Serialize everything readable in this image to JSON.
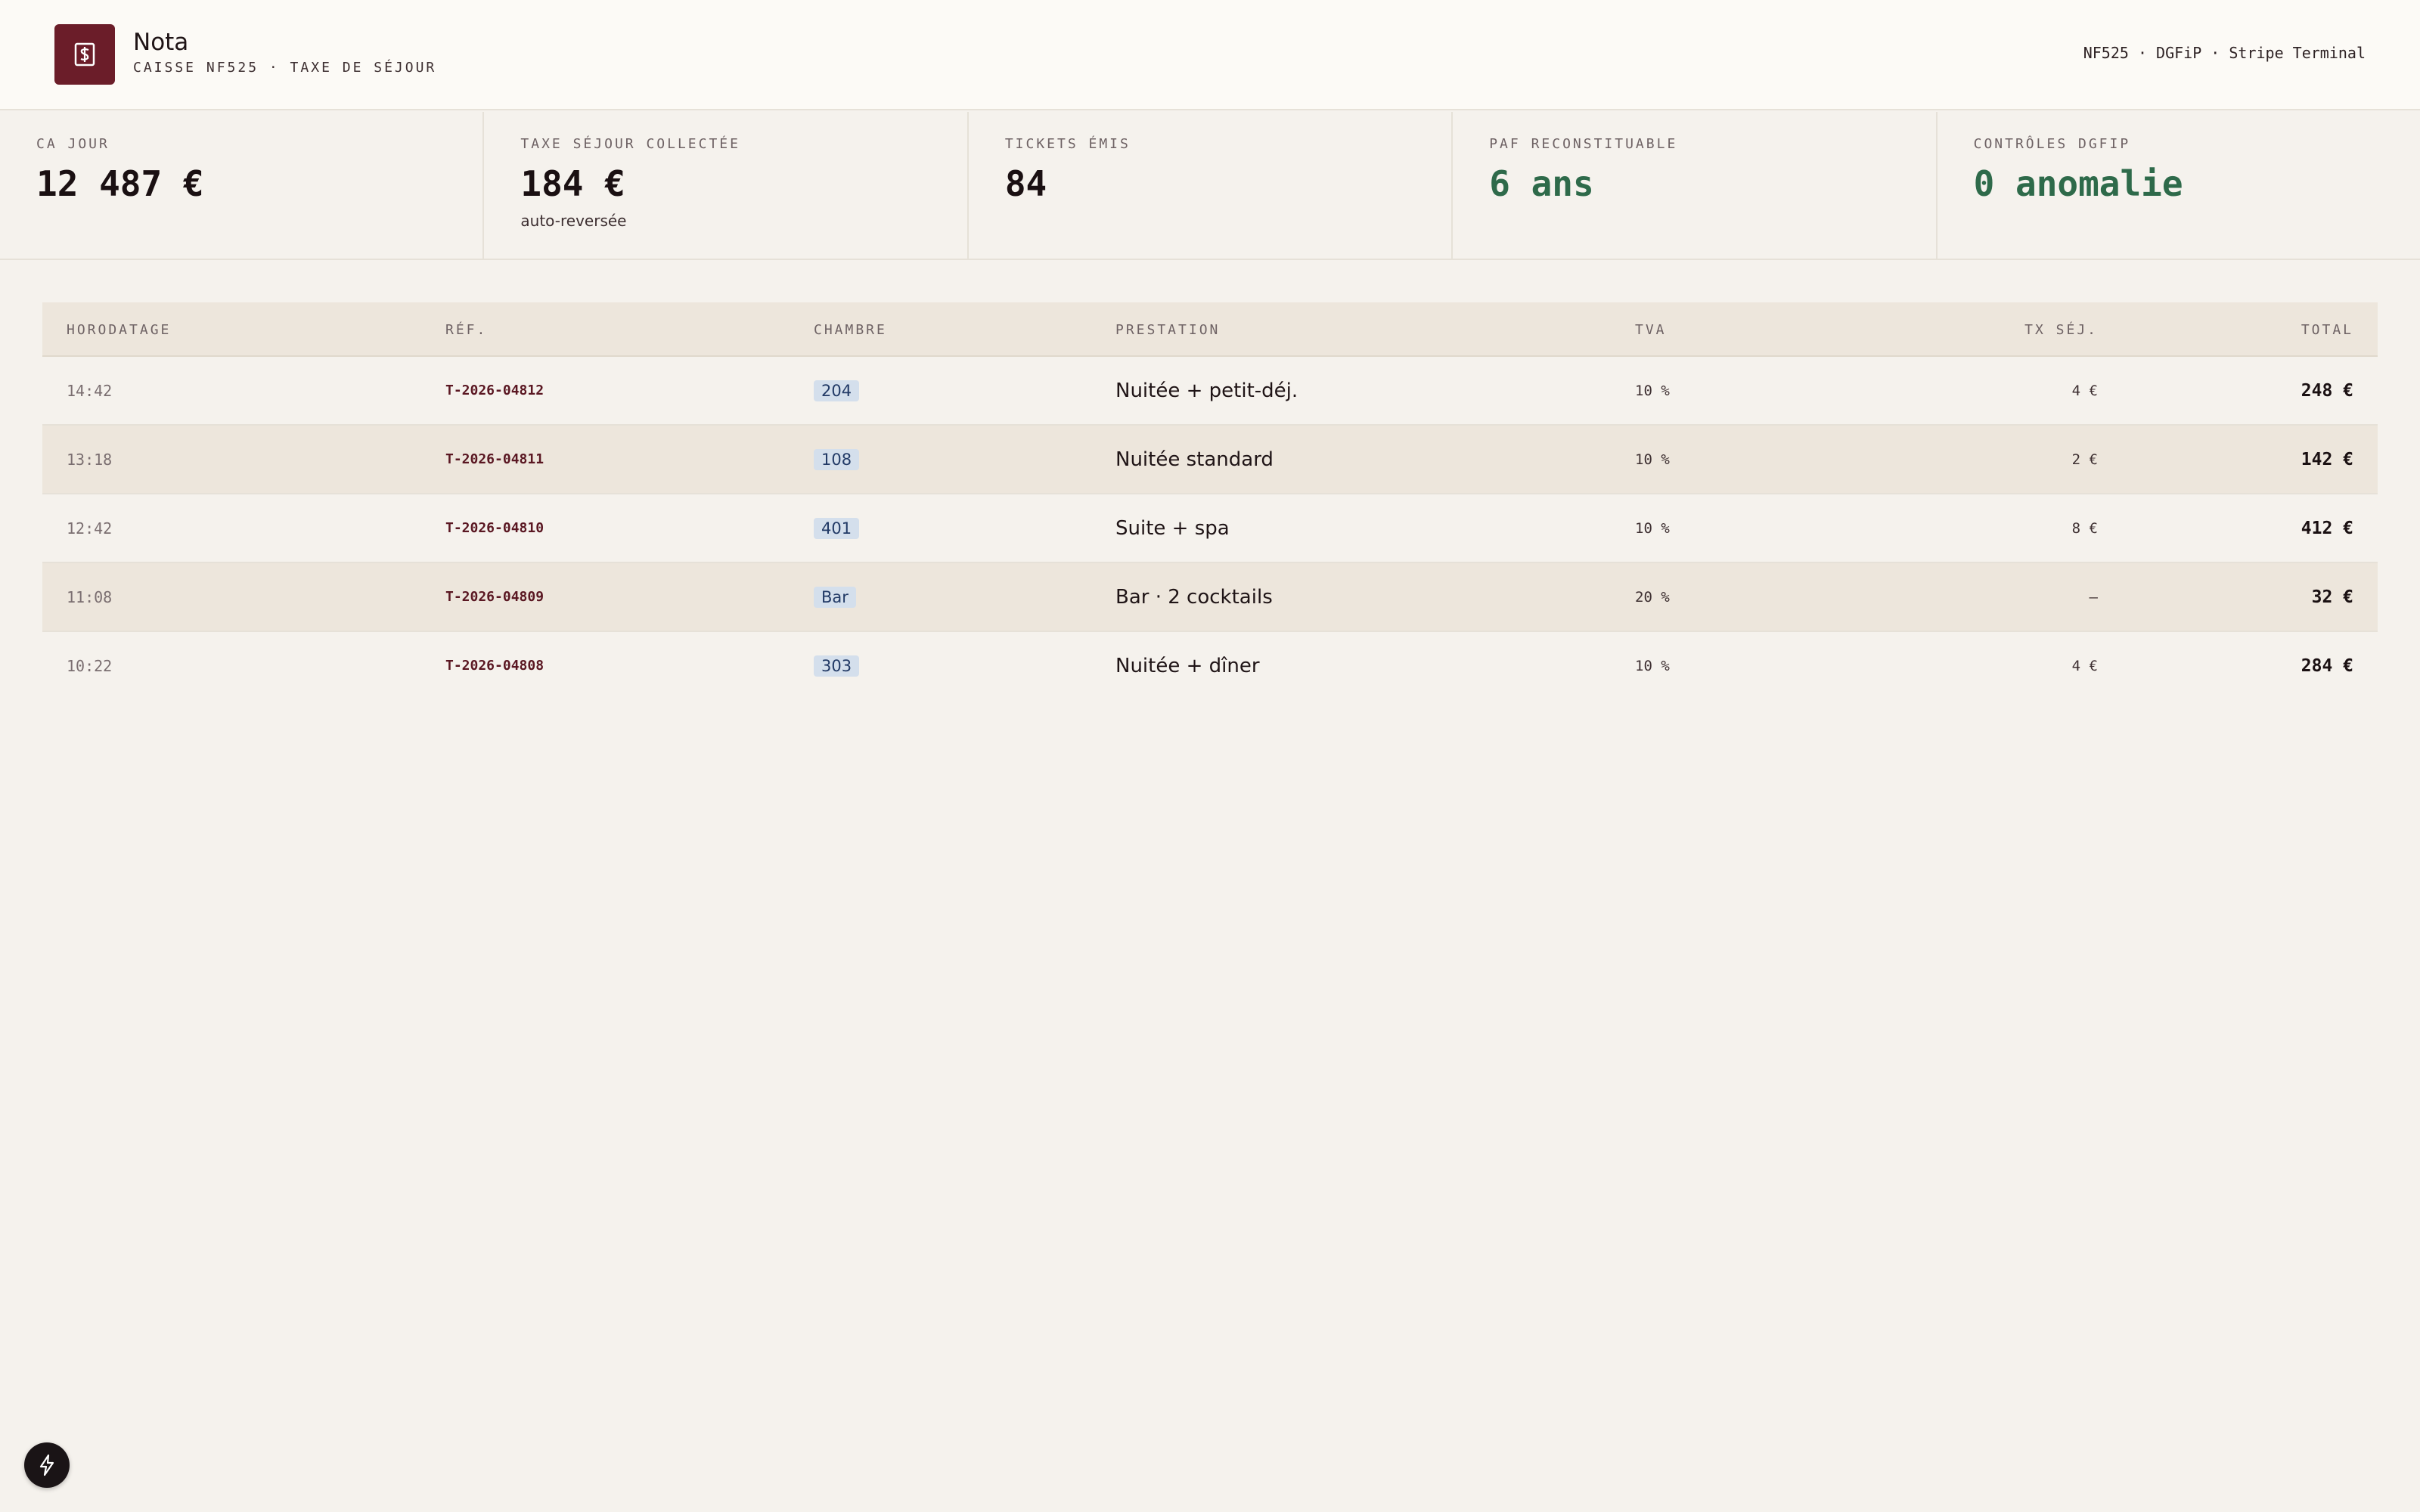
{
  "header": {
    "app_name": "Nota",
    "subtitle": "CAISSE NF525 · TAXE DE SÉJOUR",
    "right_text": "NF525 · DGFiP · Stripe Terminal",
    "logo_icon": "dollar-receipt-icon",
    "brand_color": "#6b1d29"
  },
  "kpis": [
    {
      "label": "CA JOUR",
      "value": "12 487 €",
      "note": ""
    },
    {
      "label": "TAXE SÉJOUR COLLECTÉE",
      "value": "184 €",
      "note": "auto-reversée"
    },
    {
      "label": "TICKETS ÉMIS",
      "value": "84",
      "note": ""
    },
    {
      "label": "PAF RECONSTITUABLE",
      "value": "6 ans",
      "note": ""
    },
    {
      "label": "CONTRÔLES DGFIP",
      "value": "0 anomalie",
      "note": ""
    }
  ],
  "table": {
    "columns": [
      "HORODATAGE",
      "RÉF.",
      "CHAMBRE",
      "PRESTATION",
      "TVA",
      "TX SÉJ.",
      "TOTAL"
    ],
    "rows": [
      {
        "time": "14:42",
        "ref": "T-2026-04812",
        "room": "204",
        "service": "Nuitée + petit-déj.",
        "tva": "10 %",
        "tax": "4 €",
        "total": "248 €"
      },
      {
        "time": "13:18",
        "ref": "T-2026-04811",
        "room": "108",
        "service": "Nuitée standard",
        "tva": "10 %",
        "tax": "2 €",
        "total": "142 €"
      },
      {
        "time": "12:42",
        "ref": "T-2026-04810",
        "room": "401",
        "service": "Suite + spa",
        "tva": "10 %",
        "tax": "8 €",
        "total": "412 €"
      },
      {
        "time": "11:08",
        "ref": "T-2026-04809",
        "room": "Bar",
        "service": "Bar · 2 cocktails",
        "tva": "20 %",
        "tax": "–",
        "total": "32 €"
      },
      {
        "time": "10:22",
        "ref": "T-2026-04808",
        "room": "303",
        "service": "Nuitée + dîner",
        "tva": "10 %",
        "tax": "4 €",
        "total": "284 €"
      }
    ]
  },
  "fab": {
    "icon": "lightning-bolt-icon"
  }
}
